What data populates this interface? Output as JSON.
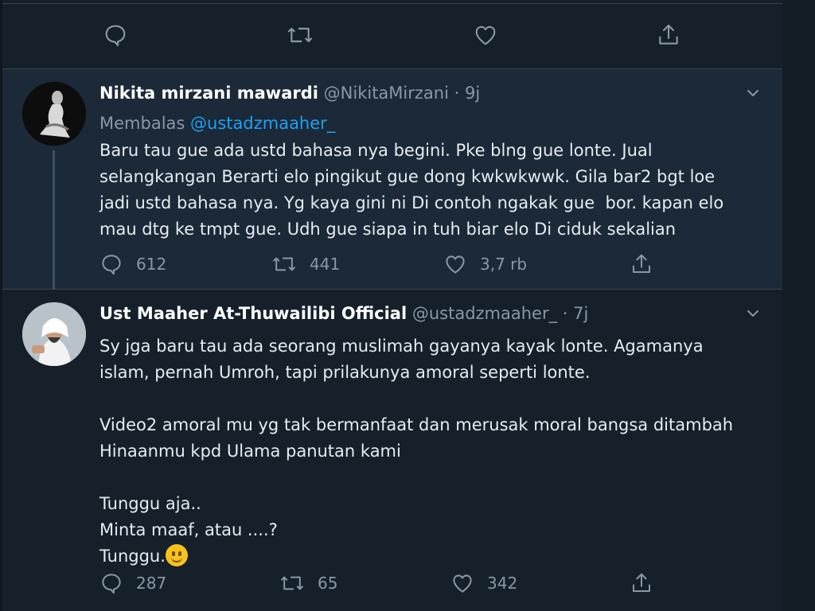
{
  "tweets": [
    {
      "display_name": "Nikita mirzani mawardi",
      "handle": "@NikitaMirzani",
      "dot": "·",
      "time": "9j",
      "reply_prefix": "Membalas",
      "reply_mention": "@ustadzmaaher_",
      "text": "Baru tau gue ada ustd bahasa nya begini. Pke blng gue lonte. Jual\nselangkangan Berarti elo pingikut gue dong kwkwkwwk. Gila bar2 bgt loe\njadi ustd bahasa nya. Yg kaya gini ni Di contoh ngakak gue  bor. kapan elo\nmau dtg ke tmpt gue. Udh gue siapa in tuh biar elo Di ciduk sekalian",
      "replies": "612",
      "retweets": "441",
      "likes": "3,7 rb"
    },
    {
      "display_name": "Ust Maaher At-Thuwailibi Official",
      "handle": "@ustadzmaaher_",
      "dot": "·",
      "time": "7j",
      "text": "Sy jga baru tau ada seorang muslimah gayanya kayak lonte. Agamanya\nislam, pernah Umroh, tapi prilakunya amoral seperti lonte.\n\nVideo2 amoral mu yg tak bermanfaat dan merusak moral bangsa ditambah\nHinaanmu kpd Ulama panutan kami\n\nTunggu aja..\nMinta maaf, atau ....?\nTunggu.",
      "replies": "287",
      "retweets": "65",
      "likes": "342"
    }
  ],
  "icons": [
    "reply-icon",
    "retweet-icon",
    "like-icon",
    "share-icon",
    "chevron-down-icon",
    "smiley-emoji"
  ],
  "colors": {
    "background": "#15202b",
    "accent": "#1da1f2",
    "muted": "#8899a6",
    "text": "#e6ecf0"
  }
}
